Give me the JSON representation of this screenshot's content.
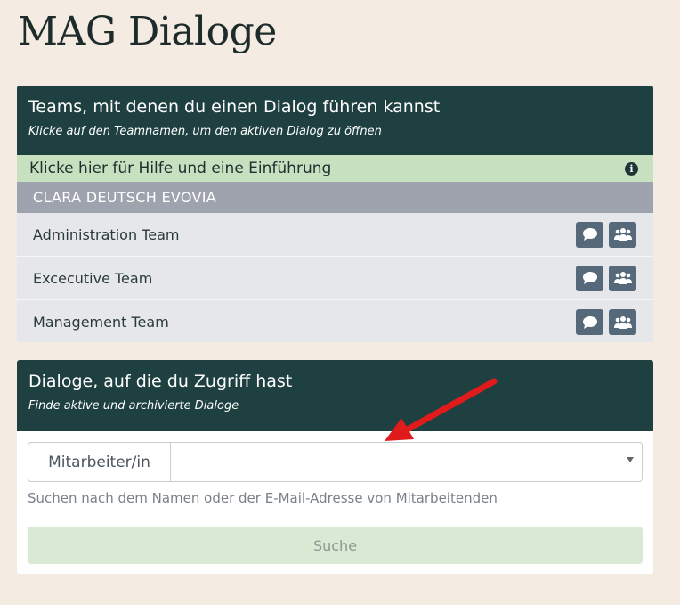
{
  "page": {
    "title": "MAG Dialoge"
  },
  "teams_card": {
    "title": "Teams, mit denen du einen Dialog führen kannst",
    "subtitle": "Klicke auf den Teamnamen, um den aktiven Dialog zu öffnen",
    "help_text": "Klicke hier für Hilfe und eine Einführung",
    "help_icon": "info-icon",
    "organization": "CLARA DEUTSCH EVOVIA",
    "teams": [
      {
        "name": "Administration Team"
      },
      {
        "name": "Excecutive Team"
      },
      {
        "name": "Management Team"
      }
    ]
  },
  "dialogs_card": {
    "title": "Dialoge, auf die du Zugriff hast",
    "subtitle": "Finde aktive und archivierte Dialoge",
    "field_label": "Mitarbeiter/in",
    "field_value": "",
    "hint": "Suchen nach dem Namen oder der E-Mail-Adresse von Mitarbeitenden",
    "search_label": "Suche"
  },
  "colors": {
    "background": "#f4ece2",
    "header": "#1f4040",
    "help_bar": "#c6e0c0",
    "org_header": "#9ea3ae",
    "icon_button": "#56697a",
    "annotation_arrow": "#e01b1b"
  }
}
